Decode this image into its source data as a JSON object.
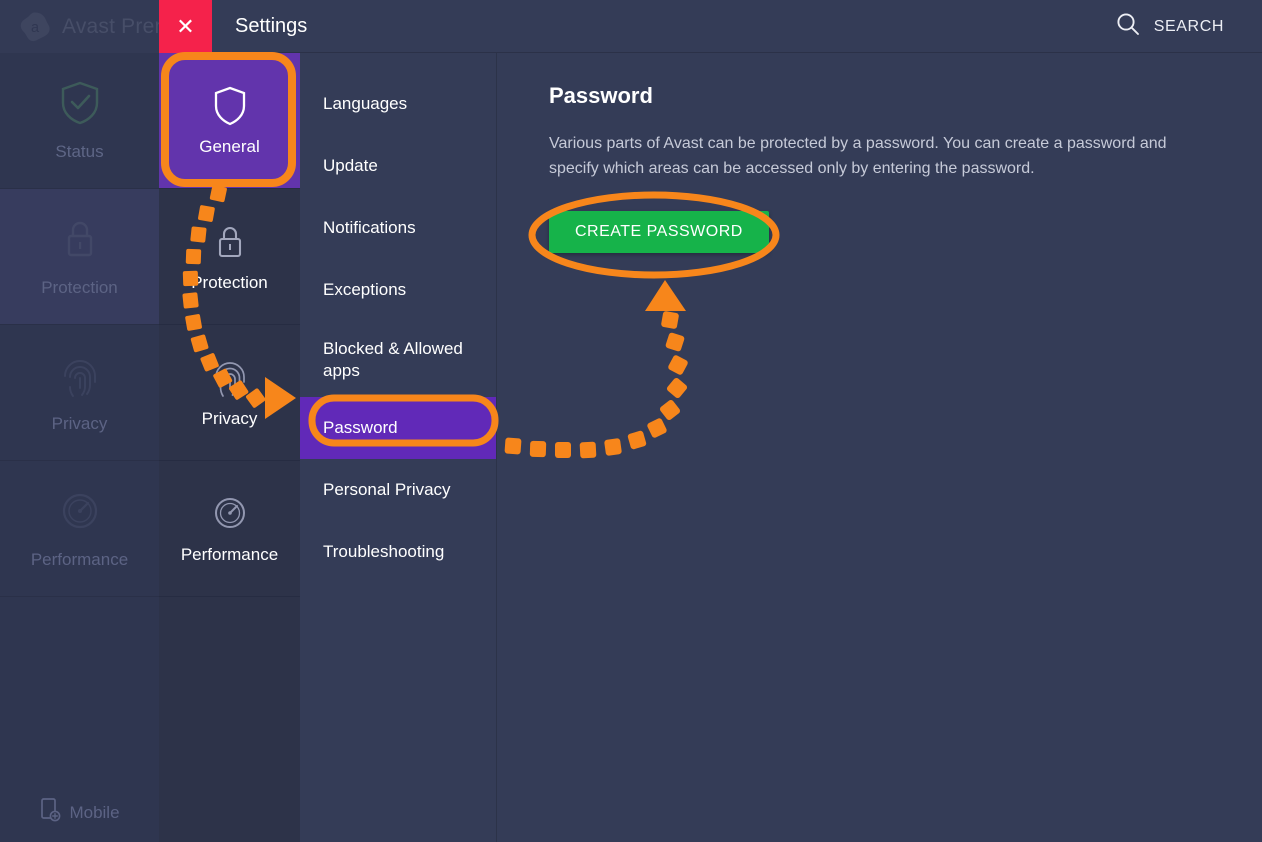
{
  "colors": {
    "accent_orange": "#f7861b",
    "brand_purple": "#6234ac",
    "selected_purple": "#6129b8",
    "close_red": "#f5224b",
    "button_green": "#16b34a",
    "panel_bg": "#343c57",
    "cat_col_bg": "#2d3349",
    "window_bg": "#2f3650"
  },
  "background_window": {
    "app_title": "Avast Prem",
    "logo_icon": "avast-logo-icon",
    "nav_items": [
      {
        "label": "Status",
        "icon": "shield-check-icon",
        "active": false
      },
      {
        "label": "Protection",
        "icon": "lock-icon",
        "active": true
      },
      {
        "label": "Privacy",
        "icon": "fingerprint-icon",
        "active": false
      },
      {
        "label": "Performance",
        "icon": "speedometer-icon",
        "active": false
      }
    ],
    "mobile": {
      "label": "Mobile",
      "icon": "mobile-add-icon"
    }
  },
  "modal": {
    "title": "Settings",
    "close_icon": "close-icon",
    "close_glyph": "✕",
    "search": {
      "label": "SEARCH",
      "icon": "search-icon"
    },
    "categories": [
      {
        "label": "General",
        "icon": "shield-icon",
        "selected": true
      },
      {
        "label": "Protection",
        "icon": "lock-icon",
        "selected": false
      },
      {
        "label": "Privacy",
        "icon": "fingerprint-icon",
        "selected": false
      },
      {
        "label": "Performance",
        "icon": "speedometer-icon",
        "selected": false
      }
    ],
    "subnav": [
      {
        "label": "Languages",
        "selected": false
      },
      {
        "label": "Update",
        "selected": false
      },
      {
        "label": "Notifications",
        "selected": false
      },
      {
        "label": "Exceptions",
        "selected": false
      },
      {
        "label": "Blocked & Allowed apps",
        "selected": false
      },
      {
        "label": "Password",
        "selected": true
      },
      {
        "label": "Personal Privacy",
        "selected": false
      },
      {
        "label": "Troubleshooting",
        "selected": false
      }
    ],
    "panel": {
      "title": "Password",
      "description": "Various parts of Avast can be protected by a password. You can create a password and specify which areas can be accessed only by entering the password.",
      "create_button": "CREATE PASSWORD"
    }
  },
  "annotations": {
    "highlight_general_tile": "orange-rounded-rect-highlight",
    "highlight_password_item": "orange-rounded-rect-highlight",
    "highlight_create_button": "orange-ellipse-highlight",
    "arrow_general_to_privacy": "orange-dotted-arrow",
    "arrow_password_to_button": "orange-dotted-arrow"
  }
}
